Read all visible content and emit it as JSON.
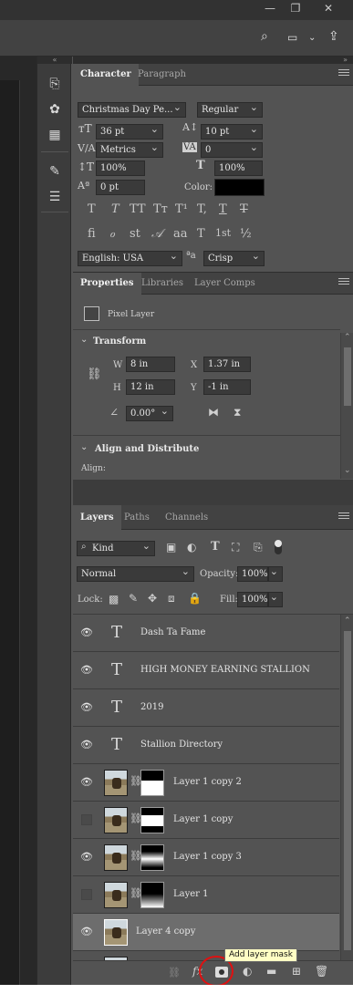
{
  "character_panel": {
    "tabs": [
      "Character",
      "Paragraph"
    ],
    "font_family": "Christmas Day Pe...",
    "font_style": "Regular",
    "font_size": "36 pt",
    "leading": "10 pt",
    "kerning": "Metrics",
    "tracking": "0",
    "vertical_scale": "100%",
    "horizontal_scale": "100%",
    "baseline_shift": "0 pt",
    "color_label": "Color:",
    "color_value": "#000000",
    "style_buttons": [
      "T",
      "T",
      "TT",
      "Tт",
      "T¹",
      "T,",
      "T",
      "T"
    ],
    "ot_buttons": [
      "fi",
      "ℴ",
      "st",
      "𝒜",
      "aa",
      "T",
      "1st",
      "½"
    ],
    "language": "English: USA",
    "aa_label": "ªa",
    "antialias": "Crisp"
  },
  "properties_panel": {
    "tabs": [
      "Properties",
      "Libraries",
      "Layer Comps"
    ],
    "layer_type": "Pixel Layer",
    "transform_label": "Transform",
    "w_label": "W",
    "w_value": "8 in",
    "h_label": "H",
    "h_value": "12 in",
    "x_label": "X",
    "x_value": "1.37 in",
    "y_label": "Y",
    "y_value": "-1 in",
    "angle_value": "0.00°",
    "align_label": "Align and Distribute",
    "align_sub": "Align:"
  },
  "layers_panel": {
    "tabs": [
      "Layers",
      "Paths",
      "Channels"
    ],
    "filter_kind": "Kind",
    "blend_mode": "Normal",
    "opacity_label": "Opacity:",
    "opacity_value": "100%",
    "lock_label": "Lock:",
    "fill_label": "Fill:",
    "fill_value": "100%",
    "layers": [
      {
        "name": "Dash Ta Fame",
        "type": "text",
        "visible": true
      },
      {
        "name": "HIGH MONEY EARNING STALLION",
        "type": "text",
        "visible": true
      },
      {
        "name": "2019",
        "type": "text",
        "visible": true
      },
      {
        "name": "Stallion Directory",
        "type": "text",
        "visible": true
      },
      {
        "name": "Layer 1 copy 2",
        "type": "masked",
        "visible": true
      },
      {
        "name": "Layer 1 copy",
        "type": "masked",
        "visible": false
      },
      {
        "name": "Layer 1 copy 3",
        "type": "masked",
        "visible": true
      },
      {
        "name": "Layer 1",
        "type": "masked",
        "visible": false
      },
      {
        "name": "Layer 4 copy",
        "type": "pixel",
        "visible": true,
        "selected": true
      }
    ],
    "tooltip": "Add layer mask"
  }
}
